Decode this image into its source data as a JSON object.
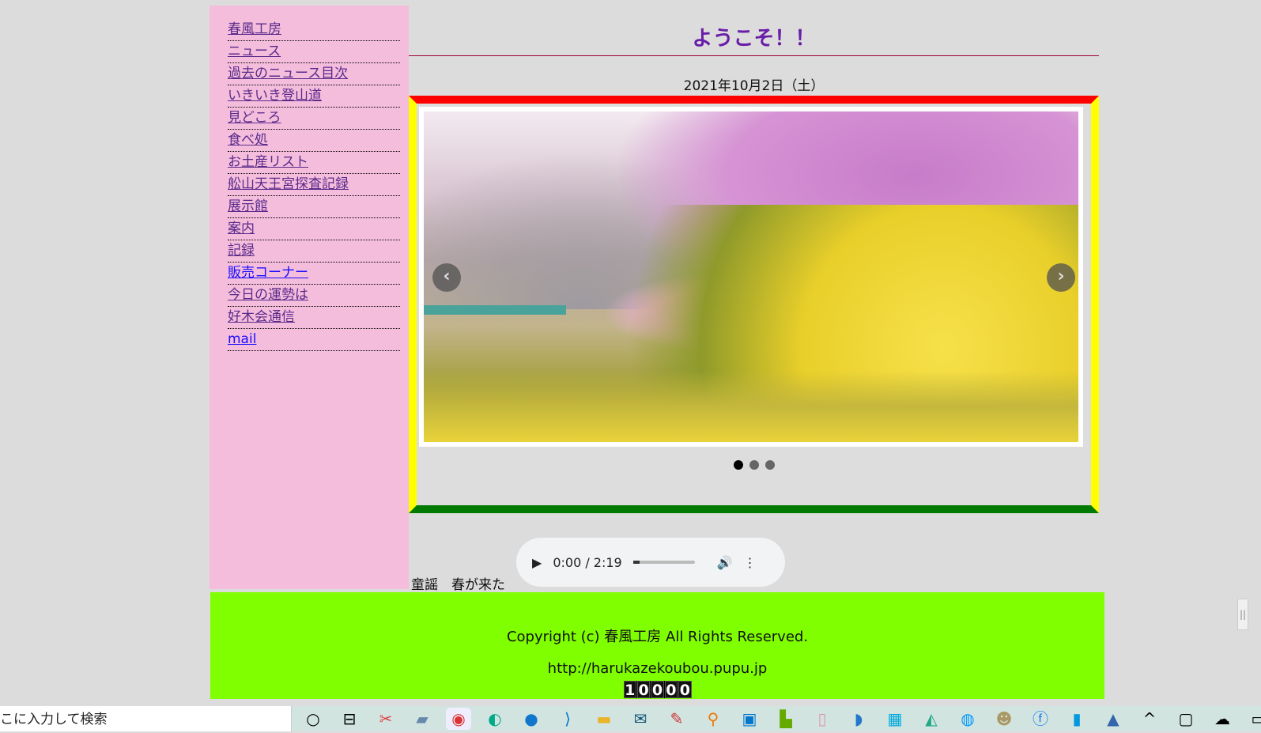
{
  "sidebar": {
    "items": [
      {
        "label": "春風工房",
        "visited": true
      },
      {
        "label": "ニュース",
        "visited": true
      },
      {
        "label": "過去のニュース目次",
        "visited": true
      },
      {
        "label": "いきいき登山道",
        "visited": true
      },
      {
        "label": "見どころ",
        "visited": true
      },
      {
        "label": "食べ処",
        "visited": true
      },
      {
        "label": "お土産リスト",
        "visited": true
      },
      {
        "label": "舩山天王宮探査記録",
        "visited": true
      },
      {
        "label": "展示館",
        "visited": true
      },
      {
        "label": "案内",
        "visited": true
      },
      {
        "label": "記録",
        "visited": true
      },
      {
        "label": "販売コーナー",
        "visited": false
      },
      {
        "label": "今日の運勢は",
        "visited": true
      },
      {
        "label": "好木会通信",
        "visited": true
      },
      {
        "label": "mail",
        "visited": false
      }
    ]
  },
  "main": {
    "title": "ようこそ！！",
    "date": "2021年10月2日（土）",
    "slider": {
      "prev": "‹",
      "next": "›",
      "slides": 3,
      "active": 1
    },
    "audio": {
      "time": "0:00 / 2:19",
      "play": "▶",
      "volume": "🔊",
      "menu": "⋮",
      "progress": 0
    },
    "song": "童謡　春が来た"
  },
  "footer": {
    "copyright": "Copyright (c) 春風工房 All Rights Reserved.",
    "url": "http://harukazekoubou.pupu.jp",
    "counter": [
      "1",
      "0",
      "0",
      "0",
      "0"
    ]
  },
  "taskbar": {
    "search_placeholder": "ここに入力して検索",
    "search_visible": "こに入力して検索"
  },
  "colors": {
    "sidebar": "#f5bddc",
    "footer": "#80ff00",
    "frame_top": "#ff0000",
    "frame_sides": "#ffff00",
    "frame_bottom": "#007a00",
    "title": "#6a1ea8"
  }
}
